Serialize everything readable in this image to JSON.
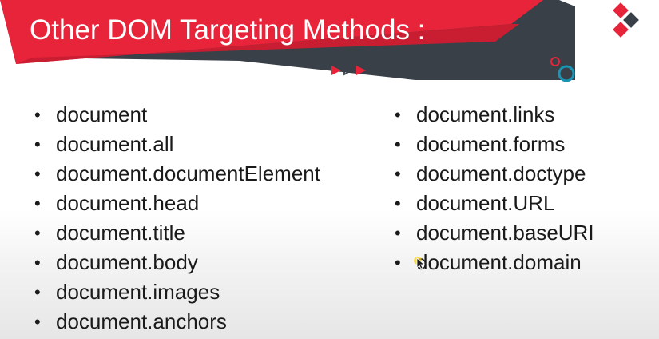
{
  "slide": {
    "title": "Other DOM Targeting Methods :"
  },
  "colors": {
    "banner_red": "#e8243a",
    "banner_dark": "#3a4048",
    "accent_teal": "#1b95b5",
    "text": "#1a1a1a"
  },
  "left_list": [
    "document",
    "document.all",
    "document.documentElement",
    "document.head",
    "document.title",
    "document.body",
    "document.images",
    "document.anchors"
  ],
  "right_list": [
    "document.links",
    "document.forms",
    "document.doctype",
    "document.URL",
    "document.baseURI",
    "document.domain"
  ],
  "icons": [
    "diamond-logo-icon",
    "play-arrows-icon",
    "circle-decoration-icon",
    "mouse-cursor-icon"
  ]
}
